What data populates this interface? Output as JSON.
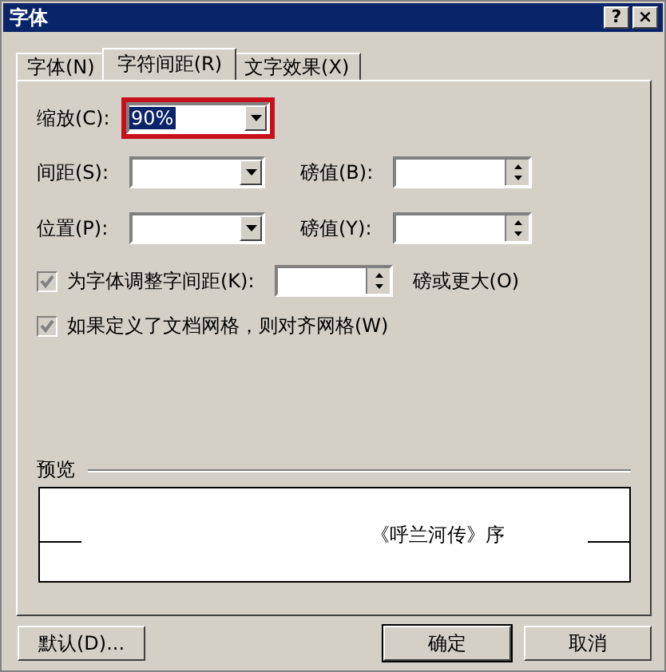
{
  "window": {
    "title": "字体",
    "help": "?",
    "close": "×"
  },
  "tabs": [
    {
      "label": "字体(N)",
      "selected": false
    },
    {
      "label": "字符间距(R)",
      "selected": true
    },
    {
      "label": "文字效果(X)",
      "selected": false
    }
  ],
  "scale": {
    "label": "缩放(C):",
    "value": "90%",
    "highlighted": true
  },
  "rows": [
    {
      "label": "间距(S):",
      "value_label": "磅值(B):"
    },
    {
      "label": "位置(P):",
      "value_label": "磅值(Y):"
    }
  ],
  "options": [
    {
      "kind": "kerning",
      "label": "为字体调整字间距(K):",
      "checked": true,
      "disabled": true,
      "suffix": "磅或更大(O)"
    },
    {
      "kind": "plain",
      "label": "如果定义了文档网格，则对齐网格(W)",
      "checked": true,
      "disabled": true
    }
  ],
  "preview": {
    "title": "预览",
    "sample": "《呼兰河传》序"
  },
  "buttons": [
    {
      "label": "默认(D)..."
    },
    {
      "label": "确定",
      "default": true
    },
    {
      "label": "取消"
    }
  ]
}
